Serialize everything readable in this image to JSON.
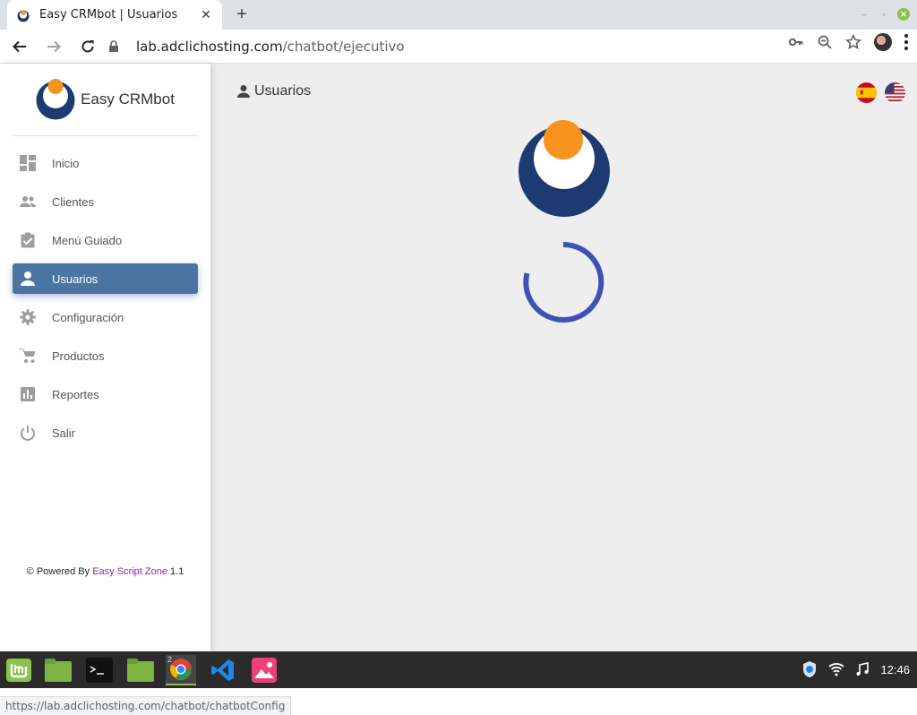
{
  "browser": {
    "tab_title": "Easy CRMbot | Usuarios",
    "new_tab": "+",
    "url_host": "lab.adclichosting.com",
    "url_path": "/chatbot/ejecutivo",
    "status_url": "https://lab.adclichosting.com/chatbot/chatbotConfig"
  },
  "brand": {
    "name": "Easy CRMbot",
    "navy": "#1e3a70",
    "orange": "#f7931e"
  },
  "sidebar": {
    "items": [
      {
        "label": "Inicio",
        "icon": "dashboard-icon"
      },
      {
        "label": "Clientes",
        "icon": "people-icon"
      },
      {
        "label": "Menú Guiado",
        "icon": "clipboard-check-icon"
      },
      {
        "label": "Usuarios",
        "icon": "person-icon",
        "active": true
      },
      {
        "label": "Configuración",
        "icon": "gear-icon"
      },
      {
        "label": "Productos",
        "icon": "cart-icon"
      },
      {
        "label": "Reportes",
        "icon": "bar-chart-icon"
      },
      {
        "label": "Salir",
        "icon": "power-icon"
      }
    ],
    "active_color": "#4a75a3"
  },
  "footer": {
    "copyright": "©",
    "powered_by": "Powered By",
    "link": "Easy Script Zone",
    "version": "1.1"
  },
  "main": {
    "title": "Usuarios",
    "spinner_color": "#3f51b5"
  },
  "taskbar": {
    "chrome_badge": "2",
    "clock": "12:46"
  }
}
